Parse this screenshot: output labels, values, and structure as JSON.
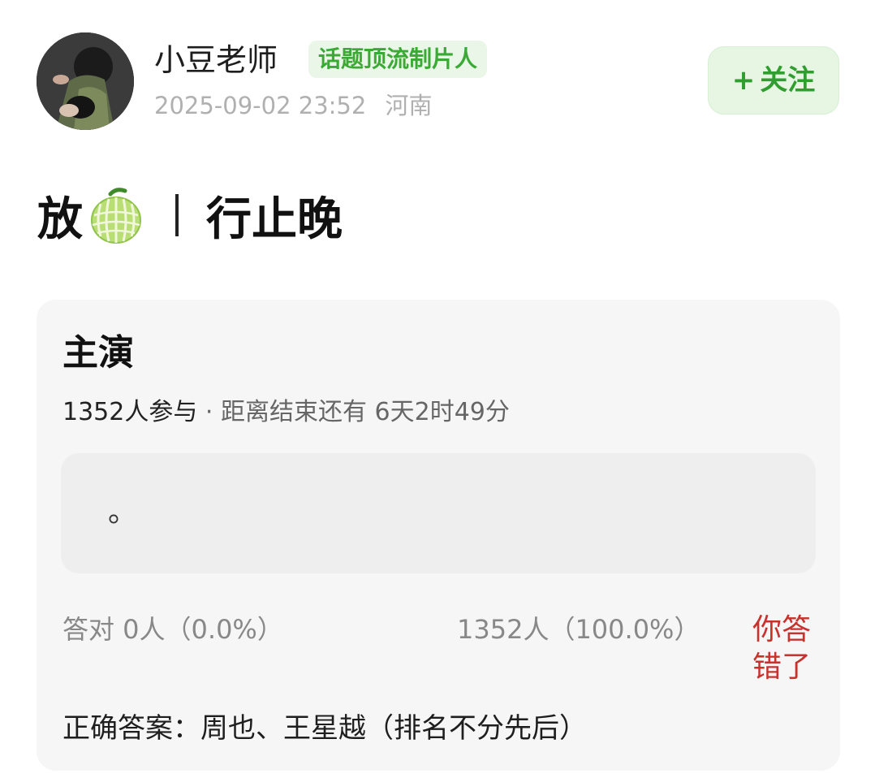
{
  "header": {
    "username": "小豆老师",
    "badge": "话题顶流制片人",
    "timestamp": "2025-09-02 23:52",
    "location": "河南",
    "follow_plus": "+",
    "follow_label": "关注",
    "icons": {
      "avatar": "user-avatar-photo",
      "follow": "plus-icon"
    }
  },
  "post": {
    "title_part1": "放",
    "title_part2": "行止晚",
    "emoji": "melon-icon"
  },
  "quiz": {
    "title": "主演",
    "participants": "1352人参与",
    "countdown": "· 距离结束还有 6天2时49分",
    "answer": "。",
    "stats_correct": "答对  0人（0.0%）",
    "stats_other": "1352人（100.0%）",
    "result": "你答错了",
    "correct_answer": "正确答案：周也、王星越（排名不分先后）"
  },
  "colors": {
    "brand_green": "#3aaa35",
    "follow_bg": "#e6f6e3",
    "wrong_red": "#c8322c",
    "card_bg": "#f6f6f6"
  }
}
